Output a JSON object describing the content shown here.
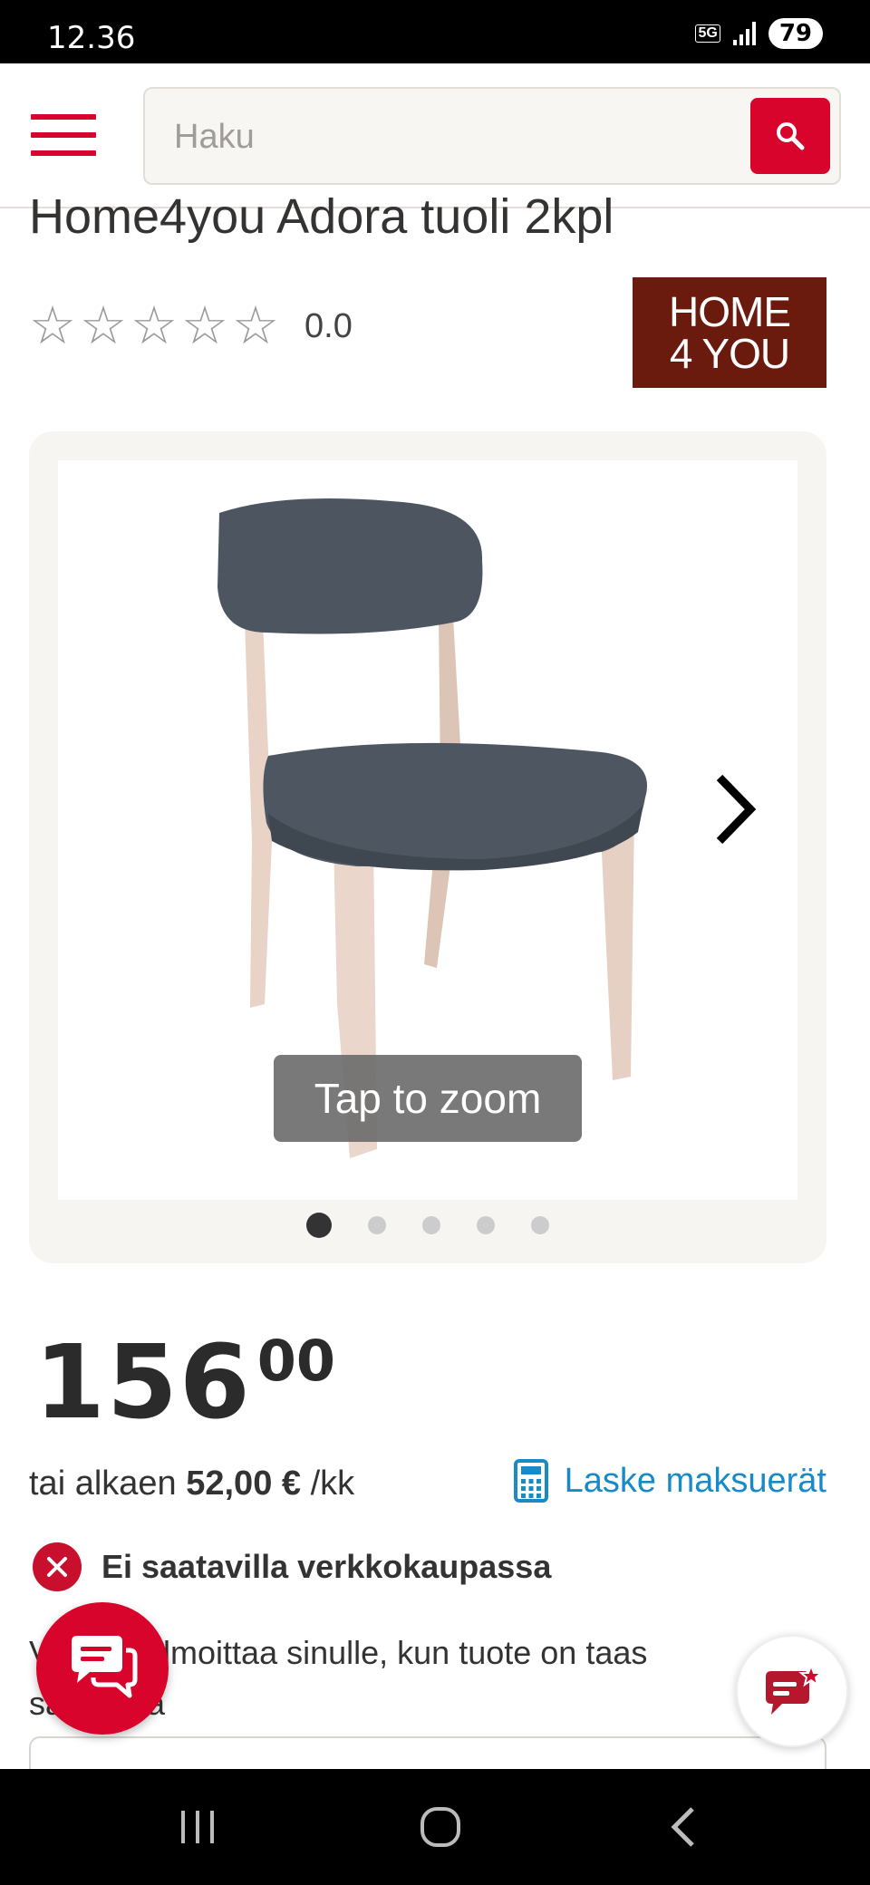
{
  "status_bar": {
    "time": "12.36",
    "network": "5G",
    "battery": "79"
  },
  "header": {
    "search_placeholder": "Haku"
  },
  "product": {
    "title": "Home4you Adora tuoli 2kpl",
    "rating": 0.0,
    "rating_text": "0.0",
    "brand_logo": {
      "line1": "HOME",
      "line2": "4 YOU",
      "color": "#6b1a0e"
    }
  },
  "gallery": {
    "zoom_hint": "Tap to zoom",
    "image_count": 5,
    "active_index": 0
  },
  "price": {
    "integer": "156",
    "decimals": "00",
    "installment_prefix": "tai alkaen",
    "installment_amount": "52,00 €",
    "installment_suffix": "/kk",
    "calculate_link": "Laske maksuerät"
  },
  "availability": {
    "status_text": "Ei saatavilla verkkokaupassa",
    "notify_text": "Voimme ilmoittaa sinulle, kun tuote on taas saatavilla"
  },
  "colors": {
    "brand_red": "#d9042b",
    "link_blue": "#1a8ac7",
    "unavailable_red": "#c8102e"
  }
}
